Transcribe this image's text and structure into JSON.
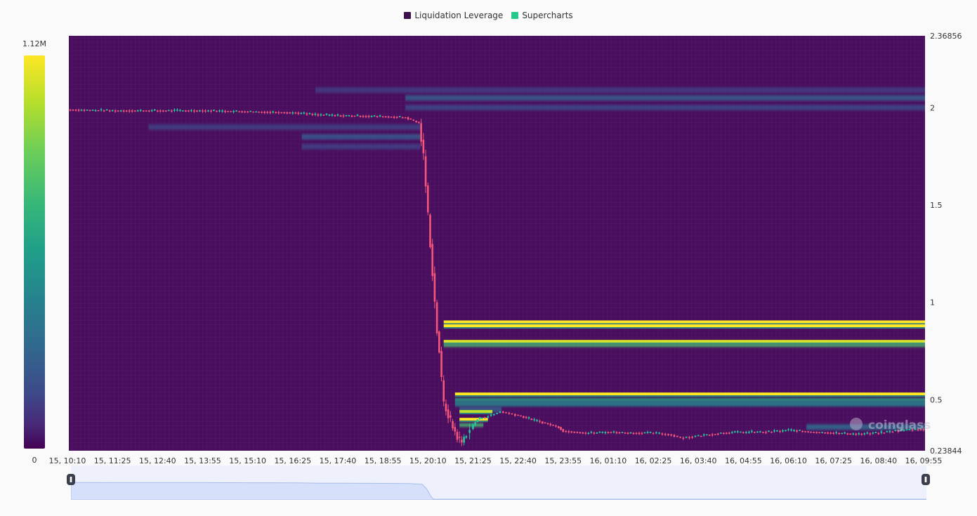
{
  "legend": [
    {
      "label": "Liquidation Leverage",
      "color": "#3d0f4d"
    },
    {
      "label": "Supercharts",
      "color": "#25c98a"
    }
  ],
  "colorbar": {
    "max_label": "1.12M",
    "min_label": "0"
  },
  "watermark": "coinglass",
  "chart_data": {
    "type": "heatmap",
    "title": "",
    "xlabel": "",
    "ylabel": "",
    "ylim": [
      0.23844,
      2.36856
    ],
    "y_ticks": [
      {
        "value": 2.36856,
        "label": "2.36856"
      },
      {
        "value": 2,
        "label": "2"
      },
      {
        "value": 1.5,
        "label": "1.5"
      },
      {
        "value": 1,
        "label": "1"
      },
      {
        "value": 0.5,
        "label": "0.5"
      },
      {
        "value": 0.23844,
        "label": "0.23844"
      }
    ],
    "x_ticks": [
      "15, 10:10",
      "15, 11:25",
      "15, 12:40",
      "15, 13:55",
      "15, 15:10",
      "15, 16:25",
      "15, 17:40",
      "15, 18:55",
      "15, 20:10",
      "15, 21:25",
      "15, 22:40",
      "15, 23:55",
      "16, 01:10",
      "16, 02:25",
      "16, 03:40",
      "16, 04:55",
      "16, 06:10",
      "16, 07:25",
      "16, 08:40",
      "16, 09:55"
    ],
    "colorscale": {
      "min": 0,
      "max": 1120000
    },
    "background_color": "#4a0e5e",
    "liquidation_bands": [
      {
        "price": 2.09,
        "start_index": 5.5,
        "end_index": 19.0,
        "intensity": 0.18
      },
      {
        "price": 2.05,
        "start_index": 7.5,
        "end_index": 19.0,
        "intensity": 0.3
      },
      {
        "price": 2.0,
        "start_index": 7.5,
        "end_index": 19.0,
        "intensity": 0.22
      },
      {
        "price": 1.9,
        "start_index": 1.8,
        "end_index": 7.8,
        "intensity": 0.2
      },
      {
        "price": 1.85,
        "start_index": 5.2,
        "end_index": 7.8,
        "intensity": 0.28
      },
      {
        "price": 1.8,
        "start_index": 5.2,
        "end_index": 7.8,
        "intensity": 0.2
      },
      {
        "price": 0.9,
        "start_index": 8.35,
        "end_index": 19.0,
        "intensity": 1.0
      },
      {
        "price": 0.88,
        "start_index": 8.35,
        "end_index": 19.0,
        "intensity": 1.0
      },
      {
        "price": 0.8,
        "start_index": 8.35,
        "end_index": 19.0,
        "intensity": 0.95
      },
      {
        "price": 0.78,
        "start_index": 8.35,
        "end_index": 19.0,
        "intensity": 0.7
      },
      {
        "price": 0.53,
        "start_index": 8.6,
        "end_index": 19.0,
        "intensity": 1.0
      },
      {
        "price": 0.5,
        "start_index": 8.6,
        "end_index": 19.0,
        "intensity": 0.6
      },
      {
        "price": 0.48,
        "start_index": 8.6,
        "end_index": 19.0,
        "intensity": 0.45
      },
      {
        "price": 0.45,
        "start_index": 8.7,
        "end_index": 9.6,
        "intensity": 0.3
      },
      {
        "price": 0.44,
        "start_index": 8.7,
        "end_index": 9.4,
        "intensity": 0.9
      },
      {
        "price": 0.4,
        "start_index": 8.7,
        "end_index": 9.3,
        "intensity": 1.0
      },
      {
        "price": 0.37,
        "start_index": 8.7,
        "end_index": 9.2,
        "intensity": 0.7
      },
      {
        "price": 0.36,
        "start_index": 16.4,
        "end_index": 19.0,
        "intensity": 0.35
      }
    ],
    "price_series": {
      "name": "Supercharts",
      "x": [
        0,
        1,
        2,
        3,
        4,
        5,
        5.5,
        6,
        7,
        7.5,
        7.8,
        7.9,
        8.0,
        8.05,
        8.1,
        8.15,
        8.2,
        8.25,
        8.3,
        8.35,
        8.45,
        8.55,
        8.65,
        8.75,
        8.85,
        9.0,
        9.1,
        9.2,
        9.4,
        9.6,
        9.8,
        10.0,
        10.3,
        10.6,
        10.9,
        11.0,
        11.5,
        12.0,
        12.5,
        13.0,
        13.4,
        13.6,
        14.0,
        14.5,
        15.0,
        15.5,
        16.0,
        16.5,
        17.0,
        17.5,
        18.0,
        18.5,
        19.0
      ],
      "close": [
        1.99,
        1.985,
        1.985,
        1.985,
        1.98,
        1.975,
        1.965,
        1.96,
        1.955,
        1.95,
        1.92,
        1.75,
        1.45,
        1.3,
        1.15,
        1.0,
        0.85,
        0.75,
        0.6,
        0.48,
        0.42,
        0.36,
        0.31,
        0.28,
        0.33,
        0.37,
        0.4,
        0.41,
        0.42,
        0.44,
        0.43,
        0.42,
        0.4,
        0.38,
        0.36,
        0.34,
        0.33,
        0.335,
        0.33,
        0.33,
        0.32,
        0.305,
        0.315,
        0.33,
        0.335,
        0.335,
        0.345,
        0.335,
        0.33,
        0.325,
        0.33,
        0.345,
        0.35
      ]
    }
  }
}
